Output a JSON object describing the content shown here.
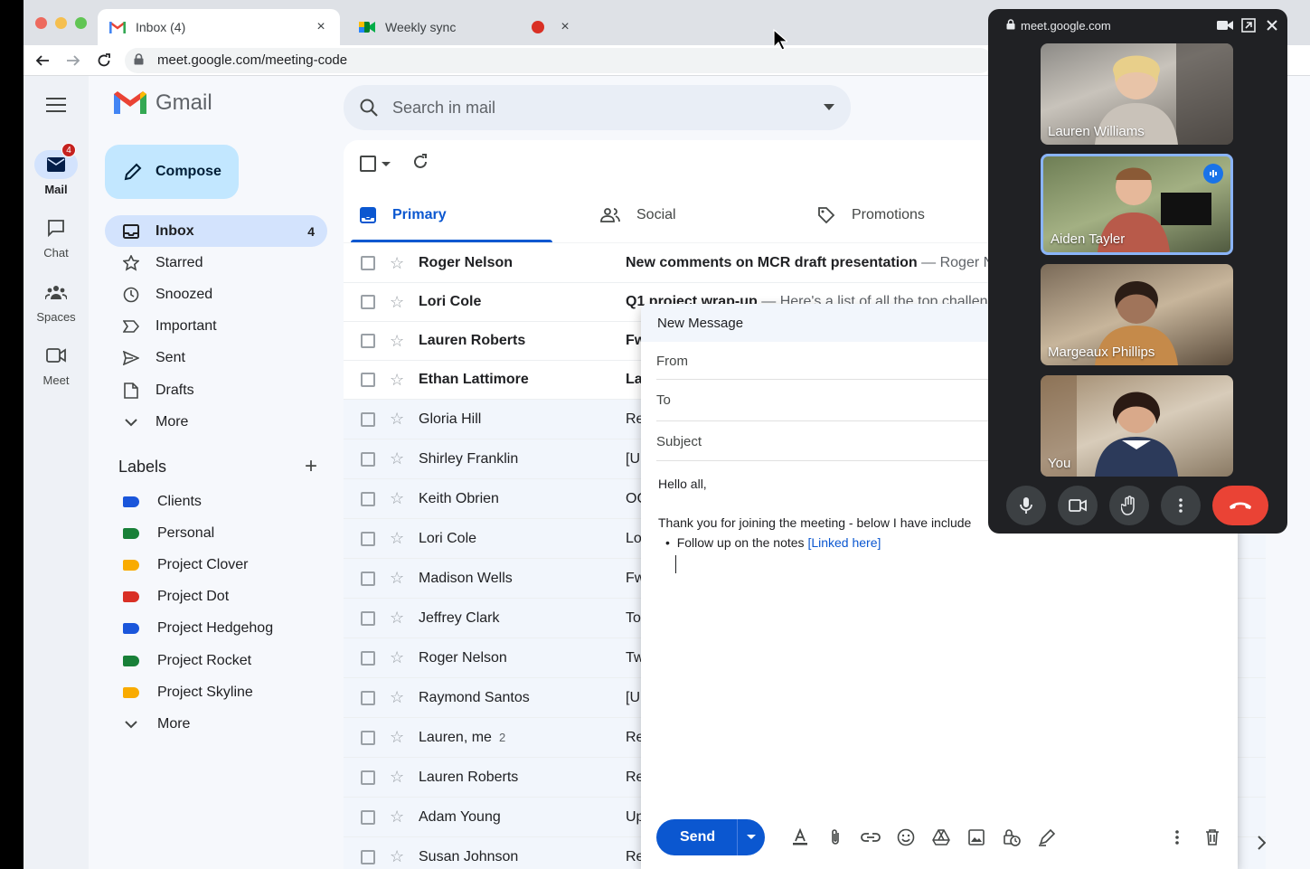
{
  "browser": {
    "tabs": [
      {
        "title": "Inbox (4)",
        "close": "×"
      },
      {
        "title": "Weekly sync",
        "close": "×"
      }
    ],
    "address": "meet.google.com/meeting-code"
  },
  "rail": {
    "items": [
      {
        "label": "Mail",
        "badge": "4",
        "icon": "mail-icon"
      },
      {
        "label": "Chat",
        "icon": "chat-icon"
      },
      {
        "label": "Spaces",
        "icon": "spaces-icon"
      },
      {
        "label": "Meet",
        "icon": "meet-icon"
      }
    ]
  },
  "gmail": {
    "logo_text": "Gmail",
    "compose_label": "Compose",
    "search_placeholder": "Search in mail",
    "nav": [
      {
        "label": "Inbox",
        "count": "4",
        "icon": "inbox-icon"
      },
      {
        "label": "Starred",
        "icon": "star-icon"
      },
      {
        "label": "Snoozed",
        "icon": "clock-icon"
      },
      {
        "label": "Important",
        "icon": "important-icon"
      },
      {
        "label": "Sent",
        "icon": "send-icon"
      },
      {
        "label": "Drafts",
        "icon": "draft-icon"
      },
      {
        "label": "More",
        "icon": "chevron-down-icon"
      }
    ],
    "labels_title": "Labels",
    "labels": [
      {
        "label": "Clients",
        "color": "#1a56db"
      },
      {
        "label": "Personal",
        "color": "#188038"
      },
      {
        "label": "Project Clover",
        "color": "#f9ab00"
      },
      {
        "label": "Project Dot",
        "color": "#d93025"
      },
      {
        "label": "Project Hedgehog",
        "color": "#1a56db"
      },
      {
        "label": "Project Rocket",
        "color": "#188038"
      },
      {
        "label": "Project Skyline",
        "color": "#f9ab00"
      }
    ],
    "labels_more": "More",
    "categories": [
      {
        "label": "Primary",
        "icon": "inbox-icon"
      },
      {
        "label": "Social",
        "icon": "people-icon"
      },
      {
        "label": "Promotions",
        "icon": "tag-icon"
      }
    ],
    "emails": [
      {
        "from": "Roger Nelson",
        "subject": "New comments on MCR draft presentation",
        "preview": " — Roger N",
        "unread": true
      },
      {
        "from": "Lori Cole",
        "subject": "Q1 project wrap-up",
        "preview": " — Here's a list of all the top challen",
        "unread": true
      },
      {
        "from": "Lauren Roberts",
        "subject": "Fw",
        "preview": "",
        "unread": true
      },
      {
        "from": "Ethan Lattimore",
        "subject": "La",
        "preview": "",
        "unread": true
      },
      {
        "from": "Gloria Hill",
        "subject": "Re",
        "preview": "",
        "unread": false
      },
      {
        "from": "Shirley Franklin",
        "subject": "[U",
        "preview": "",
        "unread": false
      },
      {
        "from": "Keith Obrien",
        "subject": "OC",
        "preview": "",
        "unread": false
      },
      {
        "from": "Lori Cole",
        "subject": "Lo",
        "preview": "",
        "unread": false
      },
      {
        "from": "Madison Wells",
        "subject": "Fw",
        "preview": "",
        "unread": false
      },
      {
        "from": "Jeffrey Clark",
        "subject": "To",
        "preview": "",
        "unread": false
      },
      {
        "from": "Roger Nelson",
        "subject": "Tw",
        "preview": "",
        "unread": false
      },
      {
        "from": "Raymond Santos",
        "subject": "[U",
        "preview": "",
        "unread": false
      },
      {
        "from": "Lauren, me",
        "count": "2",
        "subject": "Re",
        "preview": "",
        "unread": false
      },
      {
        "from": "Lauren Roberts",
        "subject": "Re",
        "preview": "",
        "unread": false
      },
      {
        "from": "Adam Young",
        "subject": "Up",
        "preview": "",
        "unread": false
      },
      {
        "from": "Susan Johnson",
        "subject": "Re",
        "preview": "",
        "unread": false
      }
    ]
  },
  "compose_window": {
    "title": "New Message",
    "from_label": "From",
    "to_label": "To",
    "subject_label": "Subject",
    "greeting": "Hello all,",
    "body_line": "Thank you for joining the meeting - below I have include",
    "bullet_text": "Follow up on the notes ",
    "bullet_link": "[Linked here]",
    "send_label": "Send"
  },
  "meet": {
    "url": "meet.google.com",
    "participants": [
      {
        "name": "Lauren Williams",
        "speaking": false
      },
      {
        "name": "Aiden Tayler",
        "speaking": true
      },
      {
        "name": "Margeaux Phillips",
        "speaking": false
      },
      {
        "name": "You",
        "speaking": false
      }
    ]
  }
}
